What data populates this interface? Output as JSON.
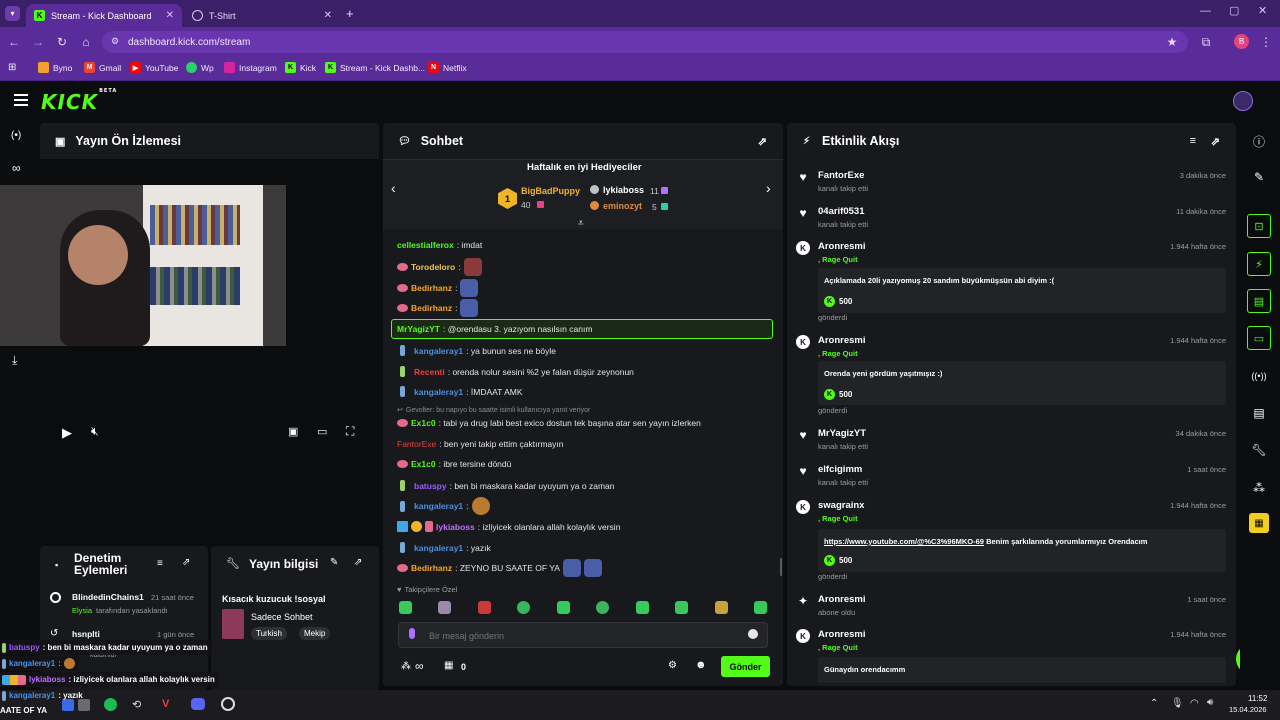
{
  "browser": {
    "tabs": [
      {
        "title": "Stream - Kick Dashboard",
        "active": true
      },
      {
        "title": "T-Shirt",
        "active": false
      }
    ],
    "url": "dashboard.kick.com/stream",
    "profile_initial": "B",
    "bookmarks": [
      {
        "label": "Byno",
        "color": "#f4a02c"
      },
      {
        "label": "Gmail",
        "color": "#e84335"
      },
      {
        "label": "YouTube",
        "color": "#ff0000"
      },
      {
        "label": "Wp",
        "color": "#25d366"
      },
      {
        "label": "Instagram",
        "color": "#d6249f"
      },
      {
        "label": "Kick",
        "color": "#53fc18"
      },
      {
        "label": "Stream - Kick Dashb...",
        "color": "#53fc18"
      },
      {
        "label": "Netflix",
        "color": "#e50914"
      }
    ]
  },
  "kick": {
    "logo": "KICK",
    "logo_tag": "BETA",
    "accent": "#53fc18"
  },
  "preview": {
    "title": "Yayın Ön İzlemesi"
  },
  "actions": {
    "title_line1": "Denetim",
    "title_line2": "Eylemleri",
    "items": [
      {
        "name": "BlindedinChains1",
        "time": "21 saat önce",
        "detail_user": "Elysia",
        "detail": "tarafından yasaklandı"
      },
      {
        "name": "hsnplti",
        "time": "1 gün önce",
        "detail_user": "",
        "detail": "kaldırıldı"
      }
    ]
  },
  "stream_info": {
    "title": "Yayın bilgisi",
    "stream_title": "Kısacık kuzucuk !sosyal",
    "category": "Sadece Sohbet",
    "tags": [
      "Turkish",
      "Mekip"
    ]
  },
  "chat": {
    "title": "Sohbet",
    "gifters_title": "Haftalık en iyi Hediyeciler",
    "top_gifter": {
      "rank": "1",
      "name": "BigBadPuppy",
      "count": "40"
    },
    "gifters": [
      {
        "name": "lykiaboss",
        "count": "11"
      },
      {
        "name": "eminozyt",
        "count": "5"
      }
    ],
    "messages": [
      {
        "user": "cellestialferox",
        "color": "#53fc18",
        "text": ": imdat"
      },
      {
        "user": "Torodeloro",
        "color": "#f5c542",
        "text": ":"
      },
      {
        "user": "Bedirhanz",
        "color": "#f5a623",
        "text": ":"
      },
      {
        "user": "Bedirhanz",
        "color": "#f5a623",
        "text": ":"
      },
      {
        "user": "MrYagizYT",
        "color": "#53fc18",
        "text": ": @orendasu 3. yazıyom nasılsın canım"
      },
      {
        "user": "kangaleray1",
        "color": "#4a90e2",
        "text": ": ya bunun ses ne böyle"
      },
      {
        "user": "Recenti",
        "color": "#e8403c",
        "text": ": orenda nolur sesini %2 ye falan düşür zeynonun"
      },
      {
        "user": "kangaleray1",
        "color": "#4a90e2",
        "text": ": İMDAAT AMK"
      },
      {
        "user": "Ex1c0",
        "color": "#53fc18",
        "text": ": tabi ya drug labi best exico dostun tek başına atar sen yayın izlerken"
      },
      {
        "user": "FantorExe",
        "color": "#e8403c",
        "text": ": ben yeni takip ettim çaktırmayın"
      },
      {
        "user": "Ex1c0",
        "color": "#53fc18",
        "text": ": ibre tersine döndü"
      },
      {
        "user": "batuspy",
        "color": "#9b59ff",
        "text": ": ben bi maskara kadar uyuyum ya o zaman"
      },
      {
        "user": "kangaleray1",
        "color": "#4a90e2",
        "text": ":"
      },
      {
        "user": "lykiaboss",
        "color": "#c36cff",
        "text": ": izliyicek olanlara allah kolaylık versin"
      },
      {
        "user": "kangaleray1",
        "color": "#4a90e2",
        "text": ": yazık"
      },
      {
        "user": "Bedirhanz",
        "color": "#f5a623",
        "text": ": ZEYNO BU SAATE OF YA"
      }
    ],
    "reply_note": "Gevolter: bu napıyo bu saatte isimli kullanıcıya yanıt veriyor",
    "emote_section": "Takipçilere Özel",
    "input_placeholder": "Bir mesaj gönderin",
    "count": "0",
    "send_label": "Gönder"
  },
  "activity": {
    "title": "Etkinlik Akışı",
    "events": [
      {
        "name": "FantorExe",
        "sub": "kanalı takip etti",
        "time": "3 dakika önce"
      },
      {
        "name": "04arif0531",
        "sub": "kanalı takip etti",
        "time": "11 dakika önce"
      },
      {
        "name": "Aronresmi",
        "sub": ", Rage Quit",
        "time": "1.944 hafta önce",
        "message": "Açıklamada 20li yazıyomuş 20 sandım büyükmüşsün abi diyim :(",
        "coins": "500",
        "footer": "gönderdi"
      },
      {
        "name": "Aronresmi",
        "sub": ", Rage Quit",
        "time": "1.944 hafta önce",
        "message": "Orenda yeni gördüm yaşıtmışız :)",
        "coins": "500",
        "footer": "gönderdi"
      },
      {
        "name": "MrYagizYT",
        "sub": "kanalı takip etti",
        "time": "34 dakika önce"
      },
      {
        "name": "elfcigimm",
        "sub": "kanalı takip etti",
        "time": "1 saat önce"
      },
      {
        "name": "swagrainx",
        "sub": ", Rage Quit",
        "time": "1.944 hafta önce",
        "message_link": "https://www.youtube.com/@%C3%96MKO-69",
        "message": " Benim şarkılarında yorumlarmıyız Orendacım",
        "coins": "500",
        "footer": "gönderdi"
      },
      {
        "name": "Aronresmi",
        "sub": "abone oldu",
        "time": "1 saat önce"
      },
      {
        "name": "Aronresmi",
        "sub": ", Rage Quit",
        "time": "1.944 hafta önce",
        "message": "Günaydın orendacımm"
      }
    ]
  },
  "overlay_chat": [
    {
      "user": "batuspy",
      "text": ": ben bi maskara kadar uyuyum ya o zaman"
    },
    {
      "user": "kangaleray1",
      "text": ":"
    },
    {
      "user": "lykiaboss",
      "text": ": izliyicek olanlara allah kolaylık versin"
    },
    {
      "user": "kangaleray1",
      "text": ": yazık"
    }
  ],
  "overlay_left": "AATE OF YA",
  "taskbar": {
    "time": "11:52",
    "date": "15.04.2026"
  }
}
